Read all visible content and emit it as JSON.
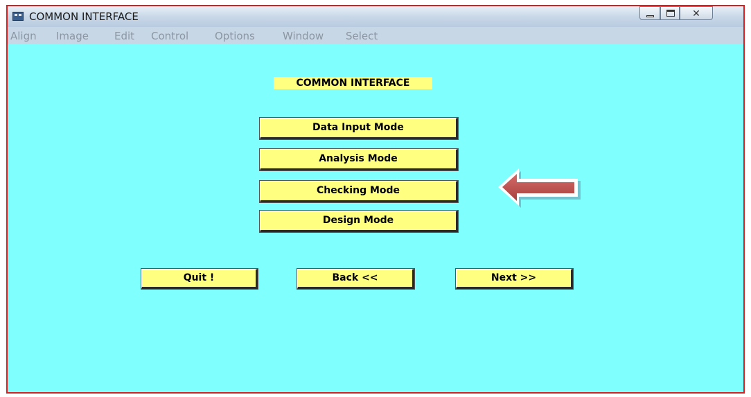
{
  "window": {
    "title": "COMMON INTERFACE",
    "controls": {
      "minimize": "",
      "maximize": "",
      "close": "✕"
    }
  },
  "menu": [
    "Align",
    "Image",
    "Edit",
    "Control",
    "Options",
    "Window",
    "Select"
  ],
  "panel": {
    "title": "COMMON INTERFACE"
  },
  "modes": [
    "Data Input Mode",
    "Analysis Mode",
    "Checking Mode",
    "Design Mode"
  ],
  "nav": {
    "quit": "Quit !",
    "back": "Back  <<",
    "next": "Next >>"
  },
  "colors": {
    "background": "#80ffff",
    "button": "#ffff80",
    "arrow": "#c0504d",
    "frame": "#d81e1e"
  }
}
